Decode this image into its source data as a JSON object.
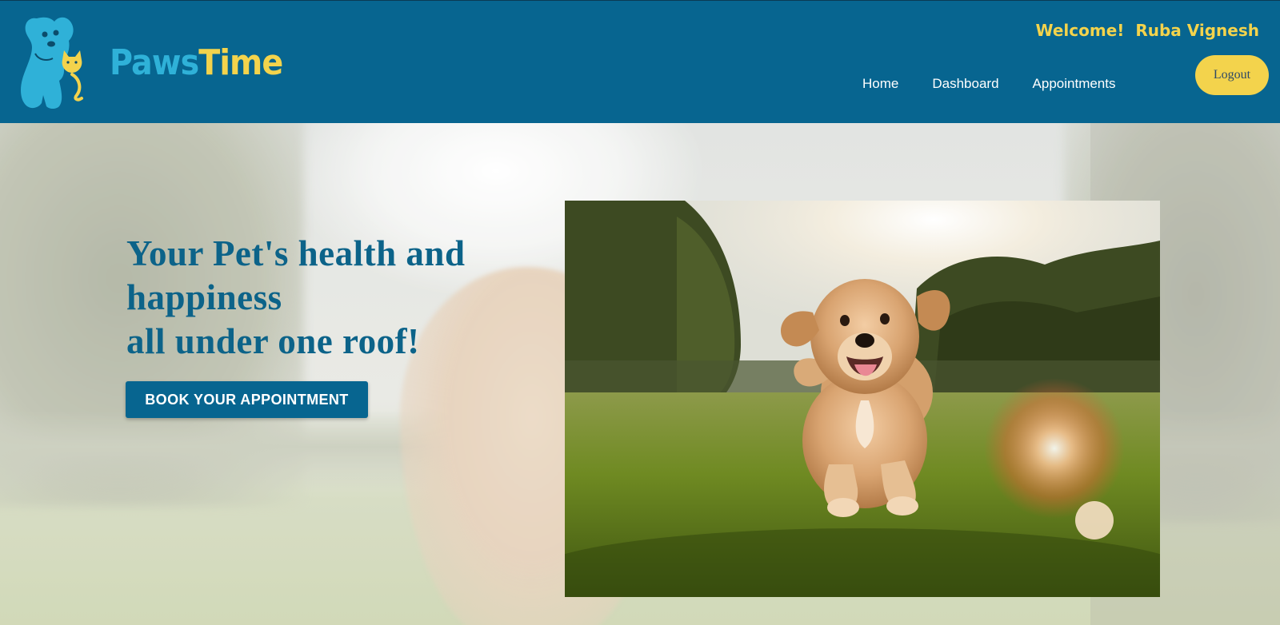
{
  "brand": {
    "name_part1": "Paws",
    "name_part2": "Time",
    "logo_icon": "dog-and-cat-logo-icon"
  },
  "header": {
    "welcome_text": "Welcome!  Ruba Vignesh",
    "nav": [
      {
        "label": "Home"
      },
      {
        "label": "Dashboard"
      },
      {
        "label": "Appointments"
      }
    ],
    "logout_label": "Logout"
  },
  "hero": {
    "title_lines": [
      "Your Pet's health and",
      "happiness",
      "all under one roof!"
    ],
    "cta_label": "BOOK YOUR APPOINTMENT",
    "image_subject": "golden-retriever-puppy-running-photo"
  },
  "colors": {
    "header_bg": "#076590",
    "accent_yellow": "#f3d34c",
    "logo_blue": "#2fb1d8",
    "title_blue": "#0c6389",
    "nav_text": "#ffffff"
  }
}
